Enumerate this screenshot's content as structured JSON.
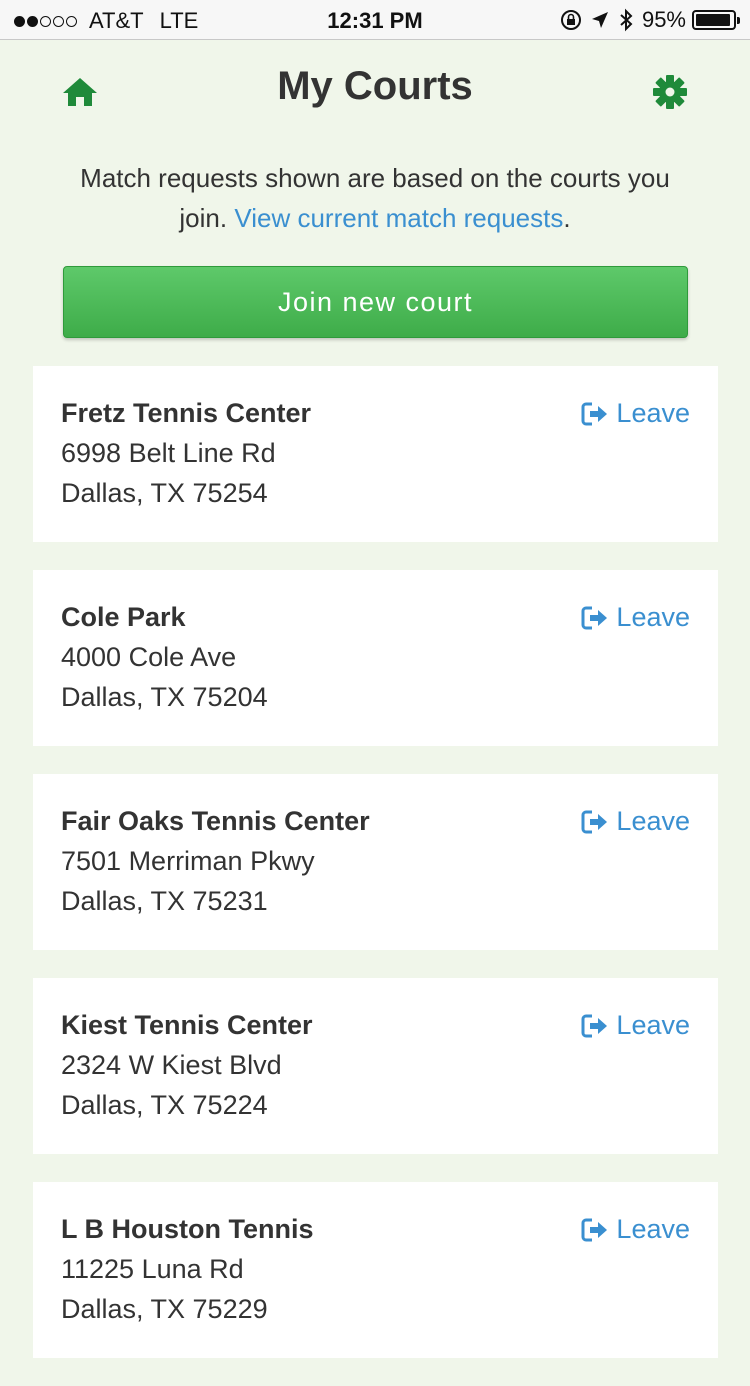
{
  "status_bar": {
    "carrier": "AT&T",
    "network": "LTE",
    "time": "12:31 PM",
    "battery": "95%",
    "battery_level": 0.95,
    "signal_bars_filled": 2,
    "signal_bars_total": 5
  },
  "header": {
    "title": "My Courts",
    "home_icon": "home-icon",
    "settings_icon": "gear-icon"
  },
  "intro": {
    "text": "Match requests shown are based on the courts you join.",
    "link": "View current match requests",
    "suffix": "."
  },
  "join_button": {
    "label": "Join new court"
  },
  "leave_label": "Leave",
  "courts": [
    {
      "name": "Fretz Tennis Center",
      "street": "6998 Belt Line Rd",
      "city": "Dallas, TX 75254"
    },
    {
      "name": "Cole Park",
      "street": "4000 Cole Ave",
      "city": "Dallas, TX 75204"
    },
    {
      "name": "Fair Oaks Tennis Center",
      "street": "7501 Merriman Pkwy",
      "city": "Dallas, TX 75231"
    },
    {
      "name": "Kiest Tennis Center",
      "street": "2324 W Kiest Blvd",
      "city": "Dallas, TX 75224"
    },
    {
      "name": "L B Houston Tennis",
      "street": "11225 Luna Rd",
      "city": "Dallas, TX 75229"
    }
  ],
  "colors": {
    "background": "#f0f6ea",
    "accent_green": "#46b351",
    "icon_green": "#1f8a3a",
    "link_blue": "#3a8fd0"
  }
}
